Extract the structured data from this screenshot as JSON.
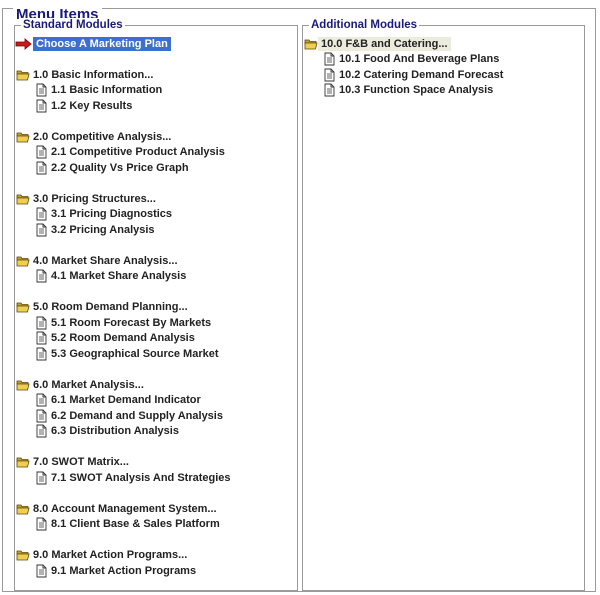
{
  "title": "Menu Items",
  "standard": {
    "title": "Standard Modules",
    "start": {
      "label": "Choose A Marketing Plan",
      "icon": "red-arrow-icon"
    },
    "groups": [
      {
        "label": "1.0 Basic Information...",
        "items": [
          "1.1 Basic Information",
          "1.2 Key Results"
        ]
      },
      {
        "label": "2.0 Competitive Analysis...",
        "items": [
          "2.1 Competitive Product Analysis",
          "2.2 Quality Vs Price Graph"
        ]
      },
      {
        "label": "3.0 Pricing Structures...",
        "items": [
          "3.1 Pricing Diagnostics",
          "3.2 Pricing Analysis"
        ]
      },
      {
        "label": "4.0 Market Share Analysis...",
        "items": [
          "4.1 Market Share Analysis"
        ]
      },
      {
        "label": "5.0 Room Demand Planning...",
        "items": [
          "5.1 Room Forecast By Markets",
          "5.2 Room Demand Analysis",
          "5.3 Geographical Source Market"
        ]
      },
      {
        "label": "6.0 Market Analysis...",
        "items": [
          "6.1 Market Demand Indicator",
          "6.2 Demand and Supply Analysis",
          "6.3 Distribution Analysis"
        ]
      },
      {
        "label": "7.0 SWOT Matrix...",
        "items": [
          "7.1 SWOT Analysis And Strategies"
        ]
      },
      {
        "label": "8.0 Account Management System...",
        "items": [
          "8.1 Client Base & Sales Platform"
        ]
      },
      {
        "label": "9.0 Market Action Programs...",
        "items": [
          "9.1 Market Action Programs"
        ]
      }
    ]
  },
  "additional": {
    "title": "Additional Modules",
    "groups": [
      {
        "label": "10.0 F&B and Catering...",
        "items": [
          "10.1 Food And Beverage Plans",
          "10.2 Catering Demand Forecast",
          "10.3 Function Space Analysis"
        ]
      }
    ]
  },
  "colors": {
    "selected_bg": "#3c6fcf",
    "title": "#1a1a7a",
    "folder": "#e8c040"
  }
}
